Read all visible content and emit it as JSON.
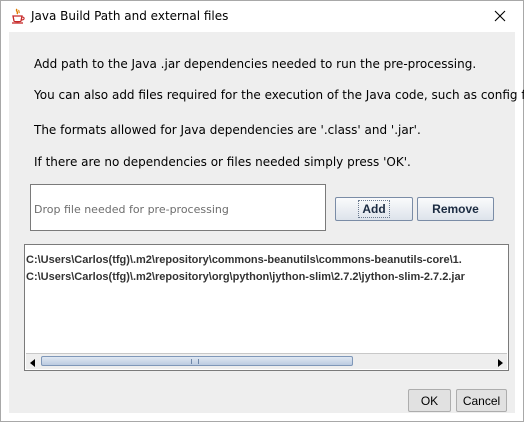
{
  "window": {
    "title": "Java Build Path and external files",
    "icon": "java-cup-icon",
    "close_icon": "close-icon"
  },
  "description": {
    "line1": "Add path to the Java .jar dependencies needed to run the pre-processing.",
    "line2": "You can also add files required for the execution of the Java code, such as config files.",
    "line3": "The formats allowed for Java dependencies are '.class' and '.jar'.",
    "line4": "If there are no dependencies or files needed simply press 'OK'."
  },
  "drop_area": {
    "placeholder": "Drop file needed for pre-processing"
  },
  "buttons": {
    "add": "Add",
    "remove": "Remove",
    "ok": "OK",
    "cancel": "Cancel"
  },
  "file_list": {
    "items": [
      "C:\\Users\\Carlos(tfg)\\.m2\\repository\\commons-beanutils\\commons-beanutils-core\\1.",
      "C:\\Users\\Carlos(tfg)\\.m2\\repository\\org\\python\\jython-slim\\2.7.2\\jython-slim-2.7.2.jar"
    ]
  },
  "colors": {
    "dialog_background": "#eeeeee",
    "button_text": "#1b2b41",
    "scroll_thumb": "#bccbe0"
  }
}
